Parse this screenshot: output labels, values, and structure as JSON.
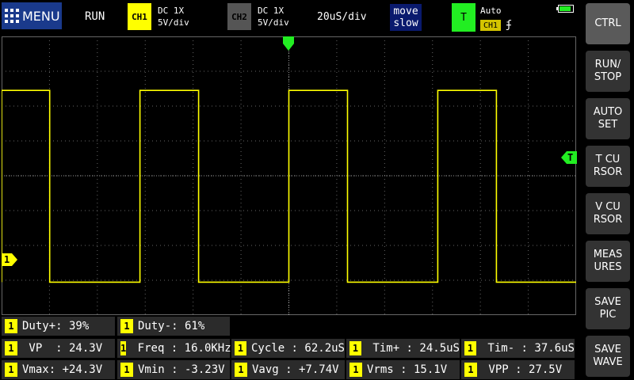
{
  "header": {
    "menu_label": "MENU",
    "run_state": "RUN",
    "ch1": {
      "tag": "CH1",
      "coupling": "DC  1X",
      "scale": "5V/div"
    },
    "ch2": {
      "tag": "CH2",
      "coupling": "DC  1X",
      "scale": "5V/div"
    },
    "timebase": "20uS/div",
    "move": {
      "line1": "move",
      "line2": "slow"
    },
    "trigger": {
      "tag": "T",
      "mode": "Auto",
      "source": "CH1",
      "edge": "ʄ"
    },
    "battery_level": 0.85
  },
  "markers": {
    "ch1": "1",
    "trigger_level": "T"
  },
  "colors": {
    "ch1": "#ffff00",
    "ch2": "#555555",
    "trigger": "#22ee22",
    "grid": "#666666"
  },
  "waveform": {
    "type": "square",
    "channel": "CH1",
    "high_v": 24.3,
    "low_v": -3.23,
    "period_us": 62.2,
    "high_time_us": 24.5,
    "time_per_div_us": 20,
    "volt_per_div": 5
  },
  "measurements": [
    {
      "ch": "1",
      "text": "Duty+: 39%"
    },
    {
      "ch": "1",
      "text": "Duty-: 61%"
    },
    {
      "ch": "1",
      "text": " VP  : 24.3V"
    },
    {
      "ch": "1",
      "text": " Freq : 16.0KHz"
    },
    {
      "ch": "1",
      "text": "Cycle : 62.2uS"
    },
    {
      "ch": "1",
      "text": " Tim+ : 24.5uS"
    },
    {
      "ch": "1",
      "text": " Tim- : 37.6uS"
    },
    {
      "ch": "1",
      "text": "Vmax: +24.3V"
    },
    {
      "ch": "1",
      "text": "Vmin : -3.23V"
    },
    {
      "ch": "1",
      "text": "Vavg : +7.74V"
    },
    {
      "ch": "1",
      "text": "Vrms : 15.1V"
    },
    {
      "ch": "1",
      "text": " VPP : 27.5V"
    }
  ],
  "sidebar": [
    "CTRL",
    "RUN/\nSTOP",
    "AUTO\nSET",
    "T CU\nRSOR",
    "V CU\nRSOR",
    "MEAS\nURES",
    "SAVE\nPIC",
    "SAVE\nWAVE"
  ]
}
